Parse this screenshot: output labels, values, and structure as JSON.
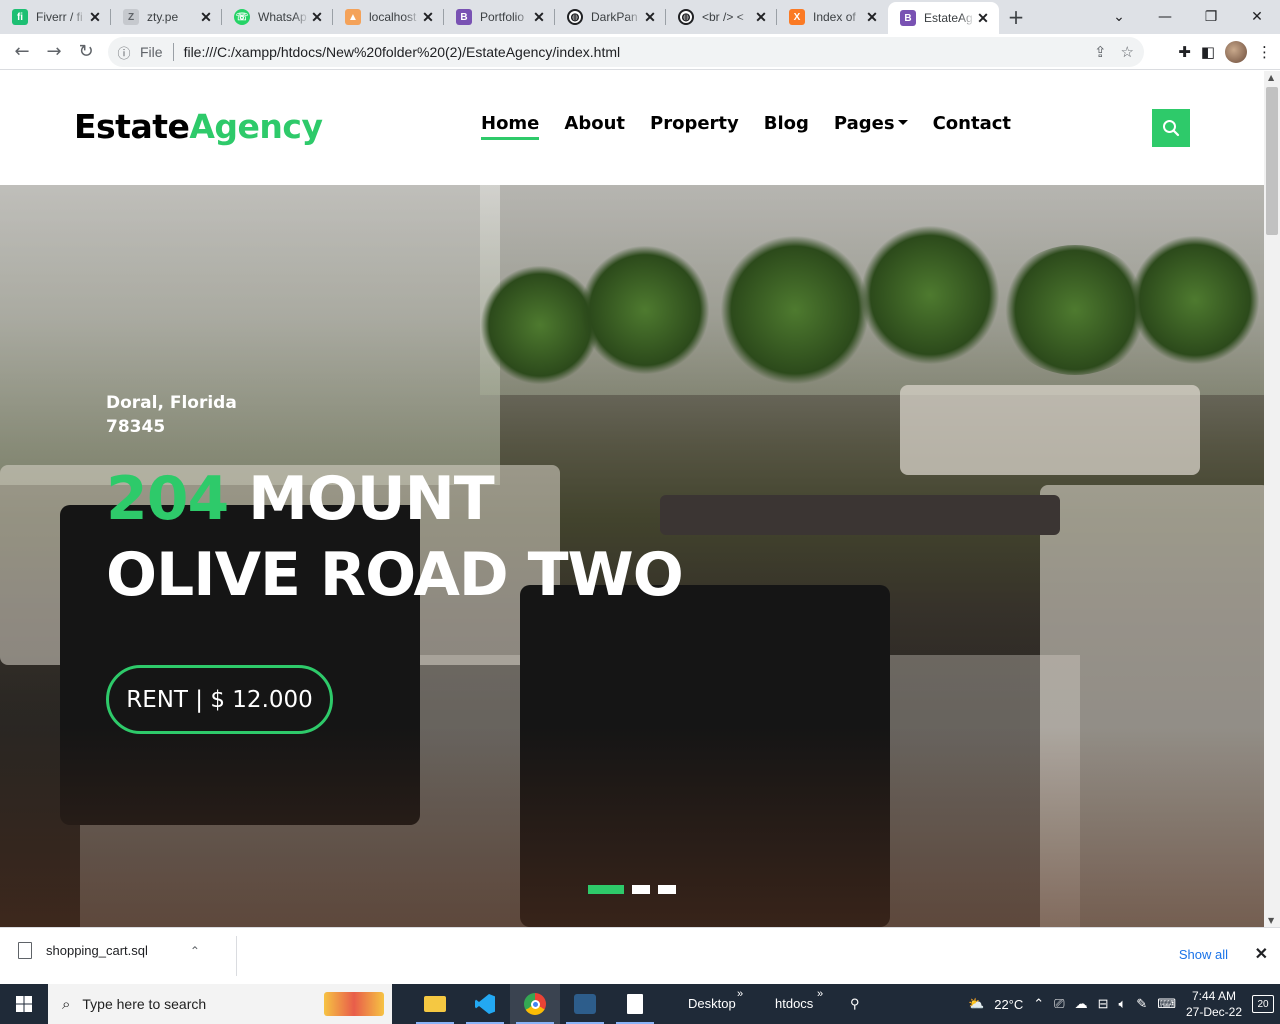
{
  "browser": {
    "tabs": [
      {
        "title": "Fiverr / fi",
        "favicon_color": "#1dbf73",
        "favicon_glyph": "fi"
      },
      {
        "title": "zty.pe",
        "favicon_color": "#9aa0a6",
        "favicon_glyph": "Z"
      },
      {
        "title": "WhatsAp",
        "favicon_color": "#25d366",
        "favicon_glyph": "☏"
      },
      {
        "title": "localhost",
        "favicon_color": "#f4a259",
        "favicon_glyph": "▲"
      },
      {
        "title": "Portfolio",
        "favicon_color": "#7952b3",
        "favicon_glyph": "B"
      },
      {
        "title": "DarkPan",
        "favicon_color": "#202124",
        "favicon_glyph": "◍"
      },
      {
        "title": "<br /> <",
        "favicon_color": "#202124",
        "favicon_glyph": "◍"
      },
      {
        "title": "Index of",
        "favicon_color": "#fb7a24",
        "favicon_glyph": "X"
      },
      {
        "title": "EstateAg",
        "favicon_color": "#7952b3",
        "favicon_glyph": "B"
      }
    ],
    "active_tab_index": 8,
    "address": {
      "scheme_label": "File",
      "url": "file:///C:/xampp/htdocs/New%20folder%20(2)/EstateAgency/index.html"
    }
  },
  "site": {
    "logo": {
      "part1": "Estate",
      "part2": "Agency"
    },
    "nav": [
      {
        "label": "Home",
        "active": true
      },
      {
        "label": "About",
        "active": false
      },
      {
        "label": "Property",
        "active": false
      },
      {
        "label": "Blog",
        "active": false
      },
      {
        "label": "Pages",
        "active": false,
        "dropdown": true
      },
      {
        "label": "Contact",
        "active": false
      }
    ],
    "accent_color": "#2eca6a",
    "search_icon": "search-icon",
    "hero": {
      "location_line1": "Doral, Florida",
      "location_line2": "78345",
      "title_number": "204",
      "title_rest_line1": " MOUNT",
      "title_line2": "OLIVE ROAD TWO",
      "price_button": "RENT | $ 12.000",
      "slides": 3,
      "current_slide": 1
    }
  },
  "downloads": {
    "file": "shopping_cart.sql",
    "show_all": "Show all"
  },
  "taskbar": {
    "search_placeholder": "Type here to search",
    "folders": [
      "Desktop",
      "htdocs"
    ],
    "weather": "22°C",
    "time": "7:44 AM",
    "date": "27-Dec-22",
    "notifications": "20"
  }
}
